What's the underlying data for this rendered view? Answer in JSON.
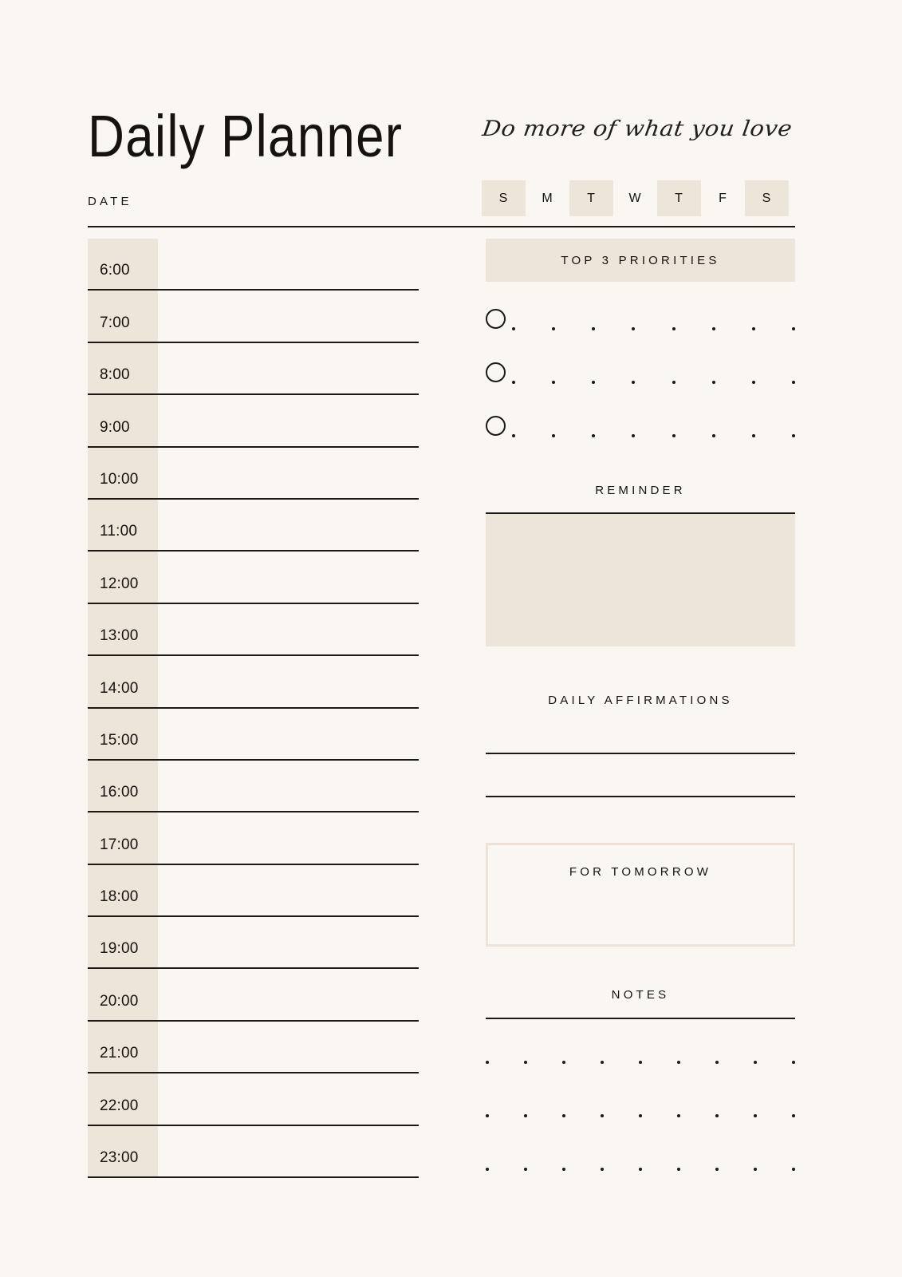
{
  "header": {
    "title": "Daily Planner",
    "tagline": "Do more of what you love"
  },
  "date": {
    "label": "DATE",
    "value": ""
  },
  "weekdays": [
    {
      "letter": "S",
      "name": "sunday",
      "filled": true
    },
    {
      "letter": "M",
      "name": "monday",
      "filled": false
    },
    {
      "letter": "T",
      "name": "tuesday",
      "filled": true
    },
    {
      "letter": "W",
      "name": "wednesday",
      "filled": false
    },
    {
      "letter": "T",
      "name": "thursday",
      "filled": true
    },
    {
      "letter": "F",
      "name": "friday",
      "filled": false
    },
    {
      "letter": "S",
      "name": "saturday",
      "filled": true
    }
  ],
  "schedule": {
    "slots": [
      {
        "time": "6:00",
        "entry": ""
      },
      {
        "time": "7:00",
        "entry": ""
      },
      {
        "time": "8:00",
        "entry": ""
      },
      {
        "time": "9:00",
        "entry": ""
      },
      {
        "time": "10:00",
        "entry": ""
      },
      {
        "time": "11:00",
        "entry": ""
      },
      {
        "time": "12:00",
        "entry": ""
      },
      {
        "time": "13:00",
        "entry": ""
      },
      {
        "time": "14:00",
        "entry": ""
      },
      {
        "time": "15:00",
        "entry": ""
      },
      {
        "time": "16:00",
        "entry": ""
      },
      {
        "time": "17:00",
        "entry": ""
      },
      {
        "time": "18:00",
        "entry": ""
      },
      {
        "time": "19:00",
        "entry": ""
      },
      {
        "time": "20:00",
        "entry": ""
      },
      {
        "time": "21:00",
        "entry": ""
      },
      {
        "time": "22:00",
        "entry": ""
      },
      {
        "time": "23:00",
        "entry": ""
      }
    ]
  },
  "priorities": {
    "heading": "TOP 3 PRIORITIES",
    "items": [
      {
        "checked": false,
        "text": ""
      },
      {
        "checked": false,
        "text": ""
      },
      {
        "checked": false,
        "text": ""
      }
    ],
    "dots_per_row": 8
  },
  "reminder": {
    "heading": "REMINDER",
    "value": ""
  },
  "affirmations": {
    "heading": "DAILY AFFIRMATIONS",
    "lines": [
      "",
      ""
    ]
  },
  "tomorrow": {
    "heading": "FOR TOMORROW",
    "value": ""
  },
  "notes": {
    "heading": "NOTES",
    "rows": [
      "",
      "",
      ""
    ],
    "dots_per_row": 9
  },
  "colors": {
    "background": "#faf7f2",
    "beige": "#ede4da",
    "border_light": "#ece2d7",
    "ink": "#16130f",
    "rule": "#1c1814"
  }
}
